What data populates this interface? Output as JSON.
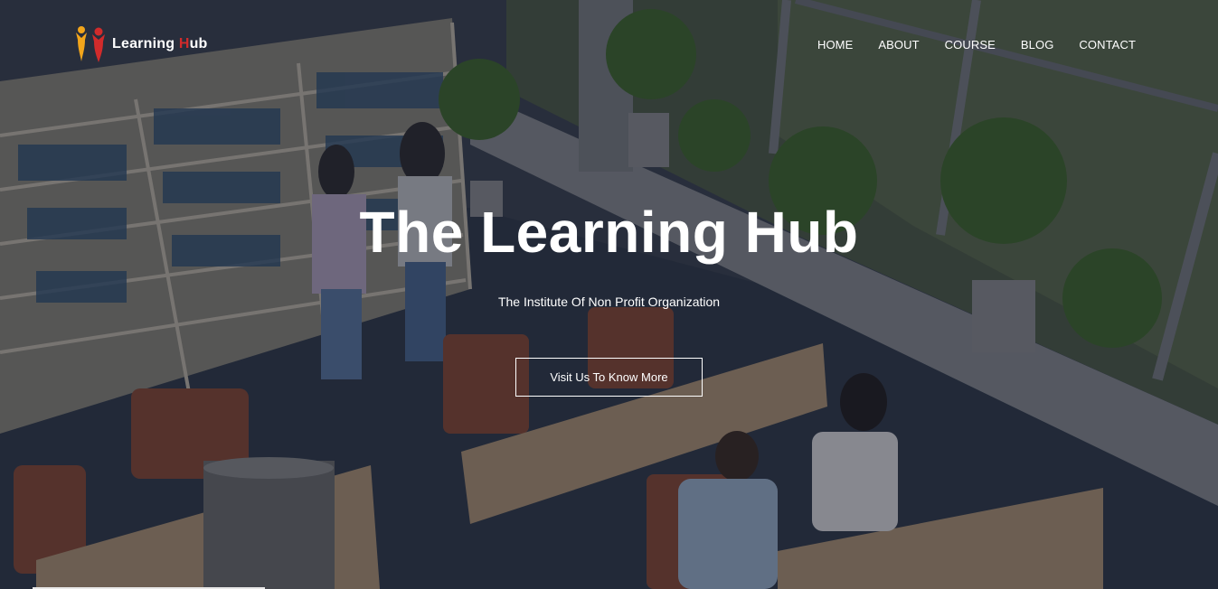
{
  "logo": {
    "text_prefix": "Learning ",
    "text_h": "H",
    "text_suffix": "ub",
    "icon": "people-logo-icon",
    "colors": {
      "orange": "#f2a51b",
      "red": "#d22b2b"
    }
  },
  "nav": {
    "items": [
      {
        "label": "HOME"
      },
      {
        "label": "ABOUT"
      },
      {
        "label": "COURSE"
      },
      {
        "label": "BLOG"
      },
      {
        "label": "CONTACT"
      }
    ]
  },
  "hero": {
    "title": "The Learning Hub",
    "subtitle": "The Institute Of Non Profit Organization",
    "cta_label": "Visit Us To Know More",
    "background": "library-photo-background"
  }
}
